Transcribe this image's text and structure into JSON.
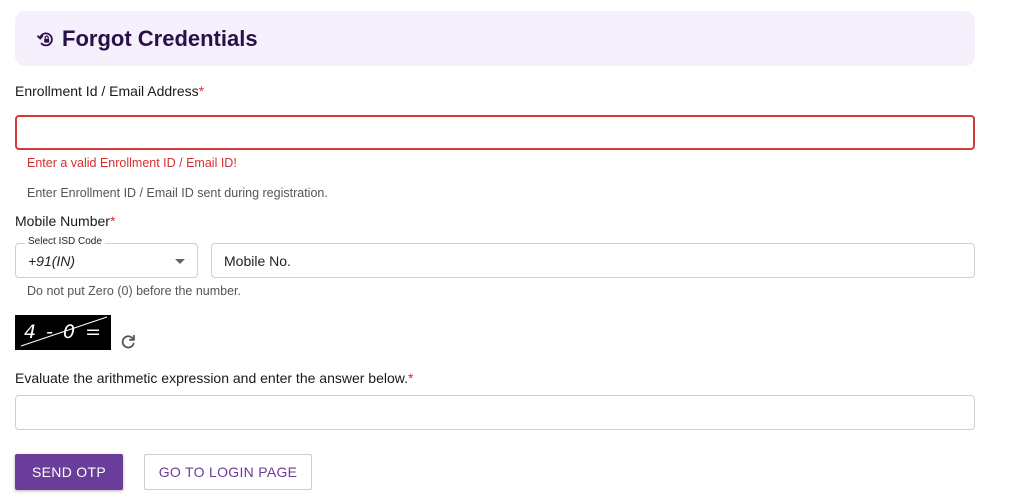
{
  "header": {
    "title": "Forgot Credentials",
    "icon": "lock-reset-icon"
  },
  "enrollment": {
    "label": "Enrollment Id / Email Address",
    "required_mark": "*",
    "value": "",
    "error": "Enter a valid Enrollment ID / Email ID!",
    "helper": "Enter Enrollment ID / Email ID sent during registration."
  },
  "mobile": {
    "label": "Mobile Number",
    "required_mark": "*",
    "isd_label": "Select ISD Code",
    "isd_value": "+91(IN)",
    "placeholder": "Mobile No.",
    "helper": "Do not put Zero (0) before the number."
  },
  "captcha": {
    "text": "4 - 0 =",
    "refresh_icon": "refresh-icon",
    "label": "Evaluate the arithmetic expression and enter the answer below.",
    "required_mark": "*",
    "value": ""
  },
  "buttons": {
    "send_otp": "SEND OTP",
    "go_login": "GO TO LOGIN PAGE"
  },
  "colors": {
    "primary": "#6a3d9a",
    "header_bg": "#f6f0fd",
    "error": "#d32f2f"
  }
}
